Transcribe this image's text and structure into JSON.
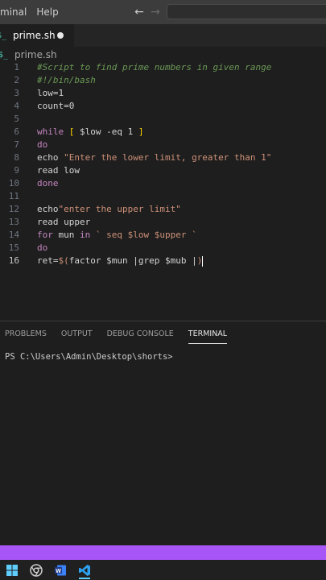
{
  "menubar": {
    "items": [
      "minal",
      "Help"
    ]
  },
  "tabs": [
    {
      "label": "prime.sh",
      "icon": "dollar-terminal-icon",
      "modified": true
    }
  ],
  "breadcrumb": {
    "file": "prime.sh"
  },
  "editor": {
    "active_line": 16,
    "lines": [
      {
        "n": "1",
        "tokens": [
          {
            "t": "#Script to find prime numbers in given range",
            "c": "cm"
          }
        ]
      },
      {
        "n": "2",
        "tokens": [
          {
            "t": "#!/bin/bash",
            "c": "cm"
          }
        ]
      },
      {
        "n": "3",
        "tokens": [
          {
            "t": "low=1",
            "c": "tx"
          }
        ]
      },
      {
        "n": "4",
        "tokens": [
          {
            "t": "count=0",
            "c": "tx"
          }
        ]
      },
      {
        "n": "5",
        "tokens": []
      },
      {
        "n": "6",
        "tokens": [
          {
            "t": "while",
            "c": "kw"
          },
          {
            "t": " ",
            "c": "tx"
          },
          {
            "t": "[",
            "c": "br"
          },
          {
            "t": " $low -eq 1 ",
            "c": "tx"
          },
          {
            "t": "]",
            "c": "br"
          }
        ]
      },
      {
        "n": "7",
        "tokens": [
          {
            "t": "do",
            "c": "kw"
          }
        ]
      },
      {
        "n": "8",
        "tokens": [
          {
            "t": "echo",
            "c": "tx"
          },
          {
            "t": " \"Enter the lower limit, greater than 1\"",
            "c": "st"
          }
        ]
      },
      {
        "n": "9",
        "tokens": [
          {
            "t": "read",
            "c": "tx"
          },
          {
            "t": " low",
            "c": "tx"
          }
        ]
      },
      {
        "n": "10",
        "tokens": [
          {
            "t": "done",
            "c": "kw"
          }
        ]
      },
      {
        "n": "11",
        "tokens": []
      },
      {
        "n": "12",
        "tokens": [
          {
            "t": "echo",
            "c": "tx"
          },
          {
            "t": "\"enter the upper limit\"",
            "c": "st"
          }
        ]
      },
      {
        "n": "13",
        "tokens": [
          {
            "t": "read",
            "c": "tx"
          },
          {
            "t": " upper",
            "c": "tx"
          }
        ]
      },
      {
        "n": "14",
        "tokens": [
          {
            "t": "for",
            "c": "kw"
          },
          {
            "t": " mun ",
            "c": "tx"
          },
          {
            "t": "in",
            "c": "kw"
          },
          {
            "t": " ` seq $low $upper `",
            "c": "st"
          }
        ]
      },
      {
        "n": "15",
        "tokens": [
          {
            "t": "do",
            "c": "kw"
          }
        ]
      },
      {
        "n": "16",
        "tokens": [
          {
            "t": "ret=",
            "c": "tx"
          },
          {
            "t": "$(",
            "c": "st"
          },
          {
            "t": "factor $mun |grep $mub |",
            "c": "tx"
          },
          {
            "t": ")",
            "c": "st"
          }
        ]
      }
    ]
  },
  "panel": {
    "tabs": [
      "PROBLEMS",
      "OUTPUT",
      "DEBUG CONSOLE",
      "TERMINAL"
    ],
    "active_tab": "TERMINAL",
    "terminal_prompt": "PS C:\\Users\\Admin\\Desktop\\shorts>"
  },
  "colors": {
    "status_bar": "#a855f7",
    "editor_bg": "#1e1e1e",
    "keyword": "#c586c0",
    "comment": "#6a9955",
    "string": "#ce9178"
  },
  "taskbar": {
    "icons": [
      "windows-start-icon",
      "chrome-icon",
      "word-icon",
      "vscode-icon"
    ],
    "active": "vscode-icon"
  }
}
